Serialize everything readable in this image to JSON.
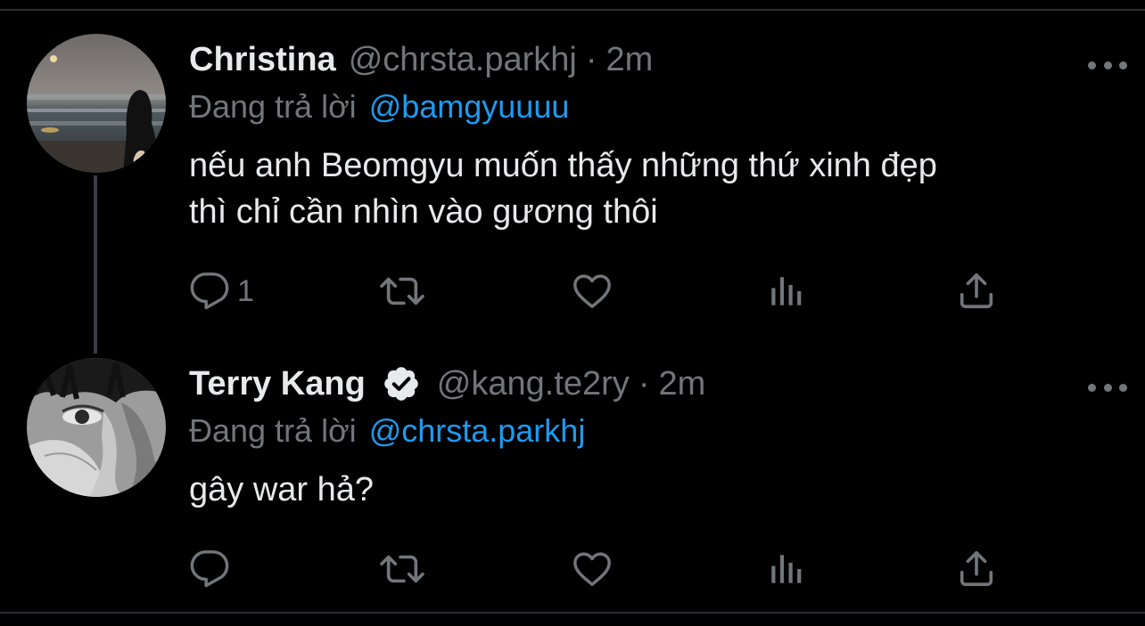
{
  "tweets": [
    {
      "display_name": "Christina",
      "verified": false,
      "handle": "@chrsta.parkhj",
      "separator": "·",
      "time": "2m",
      "reply_prefix": "Đang trả lời",
      "reply_to": "@bamgyuuuu",
      "text": "nếu anh Beomgyu muốn thấy những thứ xinh đẹp\nthì chỉ cần nhìn vào gương thôi",
      "reply_count": "1",
      "avatar": "beach-photo-avatar"
    },
    {
      "display_name": "Terry Kang",
      "verified": true,
      "handle": "@kang.te2ry",
      "separator": "·",
      "time": "2m",
      "reply_prefix": "Đang trả lời",
      "reply_to": "@chrsta.parkhj",
      "text": "gây war hả?",
      "reply_count": "",
      "avatar": "bw-portrait-avatar"
    }
  ],
  "icons": {
    "reply": "reply-icon",
    "retweet": "retweet-icon",
    "like": "heart-icon",
    "views": "views-icon",
    "share": "share-icon",
    "more": "more-icon",
    "verified": "verified-badge-icon"
  },
  "colors": {
    "background": "#000000",
    "text": "#e7e9ea",
    "muted": "#71767b",
    "link": "#1d9bf0"
  }
}
